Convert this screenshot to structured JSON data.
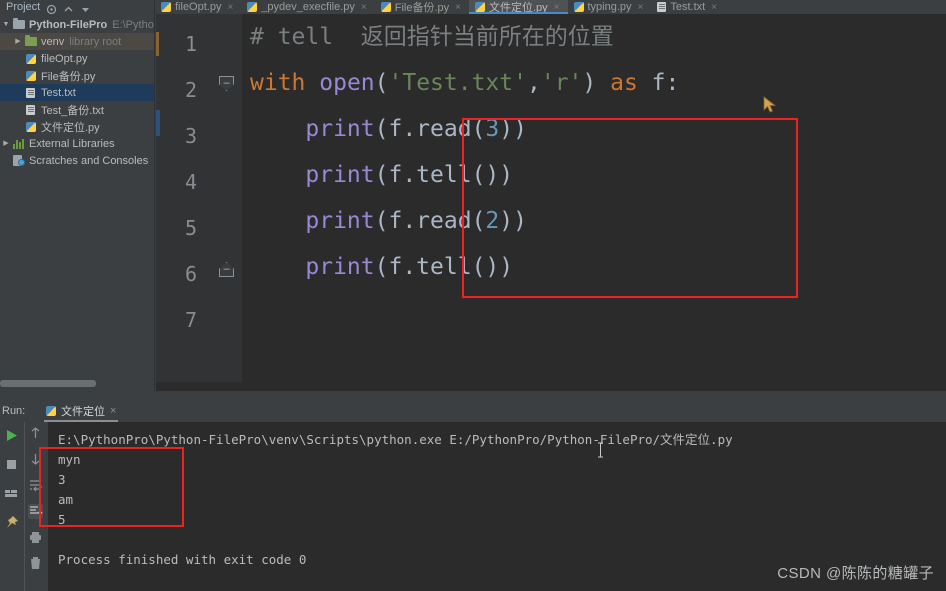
{
  "window": {
    "theme_bg": "#3c3f41",
    "editor_bg": "#2b2b2b",
    "accent": "#4a88c7",
    "highlight_red": "#ee2222",
    "selection_blue": "#1f3b5c"
  },
  "project_header": {
    "label": "Project",
    "icons": [
      "project-icon",
      "target-icon",
      "collapse-all-icon",
      "settings-gear-icon"
    ]
  },
  "editor_tabs": [
    {
      "label": "fileOpt.py",
      "icon": "python-file-icon",
      "active": false
    },
    {
      "label": "_pydev_execfile.py",
      "icon": "python-file-icon",
      "active": false
    },
    {
      "label": "File备份.py",
      "icon": "python-file-icon",
      "active": false
    },
    {
      "label": "文件定位.py",
      "icon": "python-file-icon",
      "active": true
    },
    {
      "label": "typing.py",
      "icon": "python-file-icon",
      "active": false
    },
    {
      "label": "Test.txt",
      "icon": "text-file-icon",
      "active": false
    }
  ],
  "tab_close_glyph": "×",
  "sidebar": {
    "items": [
      {
        "label": "Python-FilePro",
        "secondary": "E:\\Python",
        "icon": "folder-icon",
        "indent": 0,
        "arrow": "▼",
        "state": "root"
      },
      {
        "label": "venv",
        "secondary": "library root",
        "icon": "folder-green-icon",
        "indent": 1,
        "arrow": "▶",
        "state": "venv"
      },
      {
        "label": "fileOpt.py",
        "secondary": "",
        "icon": "python-file-icon",
        "indent": 2,
        "arrow": "",
        "state": ""
      },
      {
        "label": "File备份.py",
        "secondary": "",
        "icon": "python-file-icon",
        "indent": 2,
        "arrow": "",
        "state": ""
      },
      {
        "label": "Test.txt",
        "secondary": "",
        "icon": "text-file-icon",
        "indent": 2,
        "arrow": "",
        "state": "selected"
      },
      {
        "label": "Test_备份.txt",
        "secondary": "",
        "icon": "text-file-icon",
        "indent": 2,
        "arrow": "",
        "state": ""
      },
      {
        "label": "文件定位.py",
        "secondary": "",
        "icon": "python-file-icon",
        "indent": 2,
        "arrow": "",
        "state": ""
      },
      {
        "label": "External Libraries",
        "secondary": "",
        "icon": "libraries-icon",
        "indent": 0,
        "arrow": "▶",
        "state": ""
      },
      {
        "label": "Scratches and Consoles",
        "secondary": "",
        "icon": "scratches-icon",
        "indent": 0,
        "arrow": "",
        "state": ""
      }
    ]
  },
  "code": {
    "line_numbers": [
      "1",
      "2",
      "3",
      "4",
      "5",
      "6",
      "7"
    ],
    "fold_glyph": "–",
    "lines": [
      {
        "n": 1,
        "segments": [
          {
            "t": "# tell  返回指针当前所在的位置",
            "c": "cm"
          }
        ]
      },
      {
        "n": 2,
        "segments": [
          {
            "t": "with",
            "c": "kw"
          },
          {
            "t": " ",
            "c": "pl"
          },
          {
            "t": "open",
            "c": "bi"
          },
          {
            "t": "(",
            "c": "pl"
          },
          {
            "t": "'Test.txt'",
            "c": "str"
          },
          {
            "t": ",",
            "c": "pl"
          },
          {
            "t": "'r'",
            "c": "str"
          },
          {
            "t": ")",
            "c": "pl"
          },
          {
            "t": " ",
            "c": "pl"
          },
          {
            "t": "as",
            "c": "kw"
          },
          {
            "t": " f:",
            "c": "pl"
          }
        ]
      },
      {
        "n": 3,
        "segments": [
          {
            "t": "    ",
            "c": "pl"
          },
          {
            "t": "print",
            "c": "bi"
          },
          {
            "t": "(f.read(",
            "c": "pl"
          },
          {
            "t": "3",
            "c": "num"
          },
          {
            "t": "))",
            "c": "pl"
          }
        ]
      },
      {
        "n": 4,
        "segments": [
          {
            "t": "    ",
            "c": "pl"
          },
          {
            "t": "print",
            "c": "bi"
          },
          {
            "t": "(f.tell())",
            "c": "pl"
          }
        ]
      },
      {
        "n": 5,
        "segments": [
          {
            "t": "    ",
            "c": "pl"
          },
          {
            "t": "print",
            "c": "bi"
          },
          {
            "t": "(f.read(",
            "c": "pl"
          },
          {
            "t": "2",
            "c": "num"
          },
          {
            "t": "))",
            "c": "pl"
          }
        ]
      },
      {
        "n": 6,
        "segments": [
          {
            "t": "    ",
            "c": "pl"
          },
          {
            "t": "print",
            "c": "bi"
          },
          {
            "t": "(f.tell())",
            "c": "pl"
          }
        ]
      },
      {
        "n": 7,
        "segments": [
          {
            "t": "",
            "c": "pl"
          }
        ]
      }
    ]
  },
  "run_panel": {
    "run_label": "Run:",
    "tab_label": "文件定位",
    "tab_icon": "python-file-icon",
    "close_glyph": "×",
    "left_tools": [
      "rerun-play-icon",
      "stop-icon",
      "layout-icon",
      "pin-icon"
    ],
    "right_tools": [
      "scroll-up-icon",
      "scroll-down-icon",
      "soft-wrap-icon",
      "scroll-to-end-icon",
      "print-icon",
      "trash-icon"
    ],
    "console_command": "E:\\PythonPro\\Python-FilePro\\venv\\Scripts\\python.exe E:/PythonPro/Python-FilePro/文件定位.py",
    "console_output": [
      "myn",
      "3",
      "am",
      "5"
    ],
    "console_status": "Process finished with exit code 0"
  },
  "watermark": "CSDN @陈陈的糖罐子"
}
